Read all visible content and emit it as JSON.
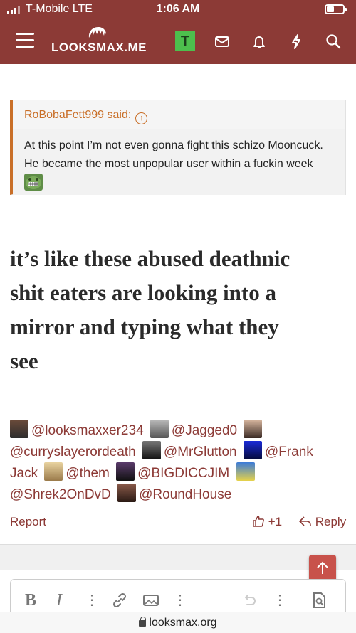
{
  "status_bar": {
    "carrier": "T-Mobile  LTE",
    "time": "1:06 AM"
  },
  "header": {
    "site_name": "LOOKSMAX.ME",
    "user_initial": "T",
    "brand_color": "#8c3a36"
  },
  "quote": {
    "author_line": "RoBobaFett999 said:",
    "text": "At this point I’m not even gonna fight this schizo Mooncuck. He became the most unpopular user within a fuckin week"
  },
  "post": {
    "lines": [
      "it’s like these abused deathnic",
      "shit eaters are looking into a",
      "mirror and typing what they",
      "see"
    ]
  },
  "mentions": [
    "@looksmaxxer234",
    "@Jagged0",
    "@curryslayerordeath",
    "@MrGlutton",
    "@Frank Jack",
    "@them",
    "@BIGDICCJIM",
    "@Shrek2OnDvD",
    "@RoundHouse"
  ],
  "actions": {
    "report": "Report",
    "like": "+1",
    "reply": "Reply"
  },
  "url_bar": {
    "domain": "looksmax.org"
  },
  "icons": [
    "hamburger-icon",
    "inbox-icon",
    "bell-icon",
    "bolt-icon",
    "search-icon",
    "bold-icon",
    "italic-icon",
    "link-icon",
    "image-icon",
    "undo-icon",
    "preview-icon",
    "thumbs-up-icon",
    "reply-icon",
    "arrow-up-icon",
    "lock-icon"
  ]
}
